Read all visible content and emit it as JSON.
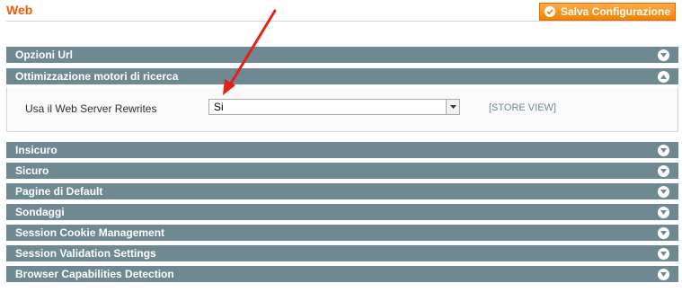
{
  "header": {
    "title": "Web",
    "save_label": "Salva Configurazione"
  },
  "sections": [
    {
      "label": "Opzioni Url",
      "state": "collapsed"
    },
    {
      "label": "Ottimizzazione motori di ricerca",
      "state": "expanded"
    },
    {
      "label": "Insicuro",
      "state": "collapsed"
    },
    {
      "label": "Sicuro",
      "state": "collapsed"
    },
    {
      "label": "Pagine di Default",
      "state": "collapsed"
    },
    {
      "label": "Sondaggi",
      "state": "collapsed"
    },
    {
      "label": "Session Cookie Management",
      "state": "collapsed"
    },
    {
      "label": "Session Validation Settings",
      "state": "collapsed"
    },
    {
      "label": "Browser Capabilities Detection",
      "state": "collapsed"
    }
  ],
  "seo_panel": {
    "field_label": "Usa il Web Server Rewrites",
    "select_value": "Si",
    "scope": "[STORE VIEW]"
  },
  "colors": {
    "accent": "#eb5e00",
    "section_bar": "#6f8992",
    "annotation_arrow": "#e32119"
  },
  "icons": [
    "checkmark-icon",
    "chevron-down-icon",
    "chevron-up-icon",
    "dropdown-arrow-icon",
    "annotation-arrow"
  ]
}
